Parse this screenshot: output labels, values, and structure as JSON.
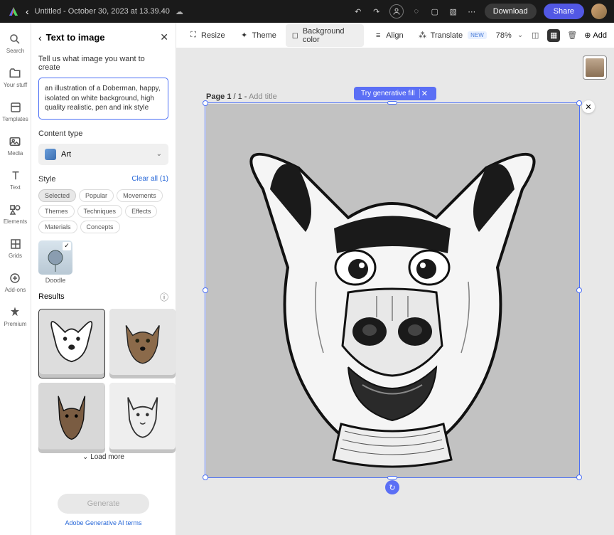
{
  "topbar": {
    "document_title": "Untitled - October 30, 2023 at 13.39.40",
    "download_label": "Download",
    "share_label": "Share"
  },
  "rail": {
    "items": [
      {
        "label": "Search"
      },
      {
        "label": "Your stuff"
      },
      {
        "label": "Templates"
      },
      {
        "label": "Media"
      },
      {
        "label": "Text"
      },
      {
        "label": "Elements"
      },
      {
        "label": "Grids"
      },
      {
        "label": "Add-ons"
      },
      {
        "label": "Premium"
      }
    ]
  },
  "panel": {
    "title": "Text to image",
    "prompt_label": "Tell us what image you want to create",
    "prompt_value": "an illustration of a Doberman, happy, isolated on white background, high quality realistic, pen and ink style",
    "content_type_label": "Content type",
    "content_type_value": "Art",
    "style_label": "Style",
    "clear_all_label": "Clear all (1)",
    "chips": [
      "Selected",
      "Popular",
      "Movements",
      "Themes",
      "Techniques",
      "Effects",
      "Materials",
      "Concepts"
    ],
    "selected_style": "Doodle",
    "results_label": "Results",
    "load_more_label": "Load more",
    "generate_label": "Generate",
    "terms_label": "Adobe Generative AI terms"
  },
  "toolbar": {
    "resize": "Resize",
    "theme": "Theme",
    "background_color": "Background color",
    "align": "Align",
    "translate": "Translate",
    "new_badge": "NEW",
    "zoom": "78%",
    "add": "Add"
  },
  "canvas": {
    "page_label_prefix": "Page 1",
    "page_label_total": " / 1 - ",
    "add_title": "Add title",
    "gen_fill_label": "Try generative fill"
  }
}
